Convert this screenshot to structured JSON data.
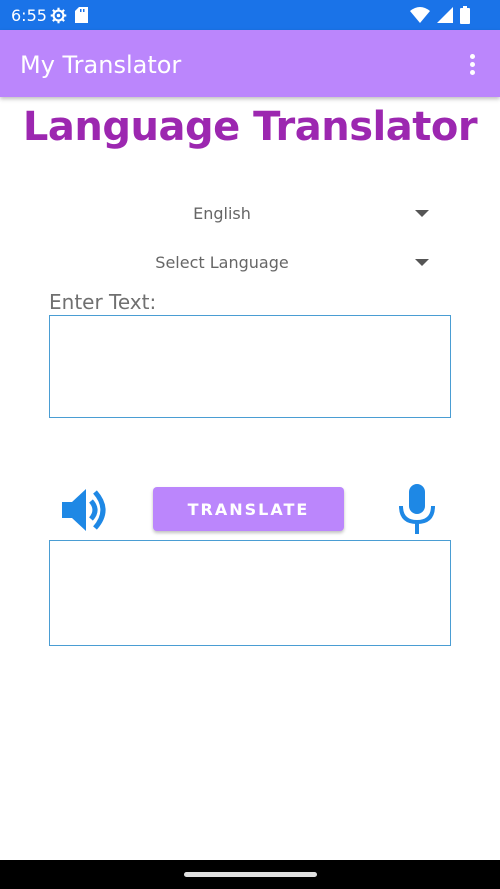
{
  "status_bar": {
    "time": "6:55",
    "background": "#1a73e8",
    "icons": [
      "settings-icon",
      "sd-card-icon",
      "wifi-icon",
      "signal-icon",
      "battery-icon"
    ]
  },
  "app_bar": {
    "title": "My Translator",
    "background": "#bb86fc",
    "menu_icon": "more-vert-icon"
  },
  "heading": {
    "text": "Language Translator",
    "color": "#9c27b0"
  },
  "source_language": {
    "selected": "English"
  },
  "target_language": {
    "selected": "Select Language"
  },
  "input": {
    "label": "Enter Text:",
    "value": ""
  },
  "actions": {
    "speak_icon": "volume-up-icon",
    "translate_label": "TRANSLATE",
    "mic_icon": "mic-icon",
    "accent": "#1e88e5"
  },
  "output": {
    "value": ""
  }
}
